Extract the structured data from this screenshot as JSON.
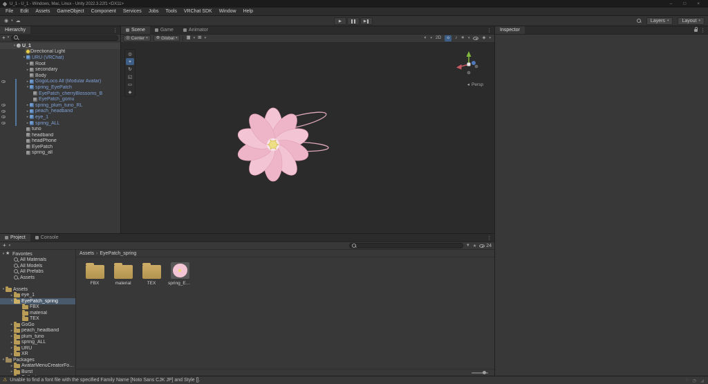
{
  "icons": {
    "plus": "+",
    "caret": "▾",
    "kebab": "⋮",
    "warning": "⚠",
    "crumb_sep": "›",
    "min": "–",
    "max": "□",
    "close": "×",
    "cloud": "☁",
    "person": "◉",
    "play": "▶",
    "shading": "◐",
    "bulb": "☼",
    "audio": "♪",
    "fx": "∗",
    "gizmos": "◈",
    "grid": "▦",
    "snap": "⊞",
    "pivot": "◎",
    "globe": "⊕",
    "funnel": "▼",
    "star": "★",
    "spinner": "◌",
    "clock": "◷",
    "grip": "◢",
    "persp_arrow": "◂"
  },
  "title_bar": {
    "title": "U_1 - U_1 - Windows, Mac, Linux - Unity 2022.3.22f1 <DX11>"
  },
  "menu_bar": {
    "items": [
      {
        "label": "File"
      },
      {
        "label": "Edit"
      },
      {
        "label": "Assets"
      },
      {
        "label": "GameObject"
      },
      {
        "label": "Component"
      },
      {
        "label": "Services"
      },
      {
        "label": "Jobs"
      },
      {
        "label": "Tools"
      },
      {
        "label": "VRChat SDK"
      },
      {
        "label": "Window"
      },
      {
        "label": "Help"
      }
    ]
  },
  "top_toolbar": {
    "layers": "Layers",
    "layout": "Layout"
  },
  "hierarchy": {
    "tab": "Hierarchy",
    "rows": [
      {
        "label": "U_1",
        "depth": "0",
        "ic": "scene",
        "arrow": "exp",
        "pf": "",
        "gut": "",
        "hdr": "1"
      },
      {
        "label": "Directional Light",
        "depth": "1",
        "ic": "light",
        "arrow": "",
        "pf": "",
        "gut": ""
      },
      {
        "label": "URU (VRChat)",
        "depth": "1",
        "ic": "prefab",
        "arrow": "exp",
        "pf": "1",
        "gut": ""
      },
      {
        "label": "Root",
        "depth": "2",
        "ic": "cube",
        "arrow": "col",
        "pf": "",
        "gut": ""
      },
      {
        "label": "secondary",
        "depth": "2",
        "ic": "cube",
        "arrow": "col",
        "pf": "",
        "gut": ""
      },
      {
        "label": "Body",
        "depth": "2",
        "ic": "cube",
        "arrow": "",
        "pf": "",
        "gut": ""
      },
      {
        "label": "GogoLoco All (Modular Avatar)",
        "depth": "2",
        "ic": "prefab",
        "arrow": "col",
        "pf": "1",
        "gut": "1"
      },
      {
        "label": "spring_EyePatch",
        "depth": "2",
        "ic": "prefab",
        "arrow": "exp",
        "pf": "1",
        "gut": ""
      },
      {
        "label": "EyePatch_cherryBlossoms_B",
        "depth": "3",
        "ic": "cube",
        "arrow": "",
        "pf": "1",
        "gut": ""
      },
      {
        "label": "EyePatch_gomu",
        "depth": "3",
        "ic": "cube",
        "arrow": "",
        "pf": "1",
        "gut": ""
      },
      {
        "label": "spring_plum_tuno_RL",
        "depth": "2",
        "ic": "prefab",
        "arrow": "col",
        "pf": "1",
        "gut": "1"
      },
      {
        "label": "peach_headband",
        "depth": "2",
        "ic": "prefab",
        "arrow": "col",
        "pf": "1",
        "gut": "1"
      },
      {
        "label": "eye_1",
        "depth": "2",
        "ic": "prefab",
        "arrow": "col",
        "pf": "1",
        "gut": "1"
      },
      {
        "label": "spring_ALL",
        "depth": "2",
        "ic": "prefab",
        "arrow": "col",
        "pf": "1",
        "gut": "1"
      },
      {
        "label": "tuno",
        "depth": "1",
        "ic": "cube",
        "arrow": "",
        "pf": "",
        "gut": ""
      },
      {
        "label": "headband",
        "depth": "1",
        "ic": "cube",
        "arrow": "",
        "pf": "",
        "gut": ""
      },
      {
        "label": "headPhone",
        "depth": "1",
        "ic": "cube",
        "arrow": "",
        "pf": "",
        "gut": ""
      },
      {
        "label": "EyePatch",
        "depth": "1",
        "ic": "cube",
        "arrow": "",
        "pf": "",
        "gut": ""
      },
      {
        "label": "spring_all",
        "depth": "1",
        "ic": "cube",
        "arrow": "",
        "pf": "",
        "gut": ""
      }
    ]
  },
  "scene_view": {
    "tabs": [
      {
        "label": "Scene",
        "active": "1",
        "name": "tab-scene"
      },
      {
        "label": "Game",
        "active": "",
        "name": "tab-game"
      },
      {
        "label": "Animator",
        "active": "",
        "name": "tab-animator"
      }
    ],
    "toolbar": {
      "pivot": "Center",
      "orientation": "Global",
      "two_d": "2D"
    },
    "tools": [
      {
        "glyph": "◎",
        "name": "view-tool",
        "active": ""
      },
      {
        "glyph": "+",
        "name": "move-tool",
        "active": "1"
      },
      {
        "glyph": "↻",
        "name": "rotate-tool",
        "active": ""
      },
      {
        "glyph": "◱",
        "name": "scale-tool",
        "active": ""
      },
      {
        "glyph": "▭",
        "name": "rect-tool",
        "active": ""
      },
      {
        "glyph": "◈",
        "name": "transform-tool",
        "active": ""
      }
    ],
    "gizmo_label": "Persp"
  },
  "inspector": {
    "tab": "Inspector"
  },
  "project": {
    "tabs": [
      {
        "label": "Project",
        "active": "1",
        "name": "tab-project"
      },
      {
        "label": "Console",
        "active": "",
        "name": "tab-console"
      }
    ],
    "hidden_count": "24",
    "tree": [
      {
        "label": "Favorites",
        "depth": "0",
        "ic": "star",
        "arrow": "exp"
      },
      {
        "label": "All Materials",
        "depth": "1",
        "ic": "search"
      },
      {
        "label": "All Models",
        "depth": "1",
        "ic": "search"
      },
      {
        "label": "All Prefabs",
        "depth": "1",
        "ic": "search"
      },
      {
        "label": "Assets",
        "depth": "1",
        "ic": "search"
      },
      {
        "sp": "1"
      },
      {
        "label": "Assets",
        "depth": "0",
        "ic": "folder",
        "arrow": "exp"
      },
      {
        "label": "eye_1",
        "depth": "1",
        "ic": "folder",
        "arrow": "col"
      },
      {
        "label": "EyePatch_spring",
        "depth": "1",
        "ic": "folder-open",
        "arrow": "exp",
        "sel": "1"
      },
      {
        "label": "FBX",
        "depth": "2",
        "ic": "folder"
      },
      {
        "label": "material",
        "depth": "2",
        "ic": "folder"
      },
      {
        "label": "TEX",
        "depth": "2",
        "ic": "folder"
      },
      {
        "label": "GoGo",
        "depth": "1",
        "ic": "folder",
        "arrow": "col"
      },
      {
        "label": "peach_headband",
        "depth": "1",
        "ic": "folder",
        "arrow": "col"
      },
      {
        "label": "plum_tuno",
        "depth": "1",
        "ic": "folder",
        "arrow": "col"
      },
      {
        "label": "spring_ALL",
        "depth": "1",
        "ic": "folder",
        "arrow": "col"
      },
      {
        "label": "URU",
        "depth": "1",
        "ic": "folder",
        "arrow": "col"
      },
      {
        "label": "XR",
        "depth": "1",
        "ic": "folder",
        "arrow": "col"
      },
      {
        "label": "Packages",
        "depth": "0",
        "ic": "package",
        "arrow": "exp"
      },
      {
        "label": "AvatarMenuCreatorForMA",
        "depth": "1",
        "ic": "folder",
        "arrow": "col"
      },
      {
        "label": "Burst",
        "depth": "1",
        "ic": "folder",
        "arrow": "col"
      },
      {
        "label": "Collections",
        "depth": "1",
        "ic": "folder",
        "arrow": "col"
      }
    ],
    "breadcrumb": {
      "root": "Assets",
      "current": "EyePatch_spring"
    },
    "items": [
      {
        "label": "FBX",
        "kind": "folder"
      },
      {
        "label": "material",
        "kind": "folder"
      },
      {
        "label": "TEX",
        "kind": "folder"
      },
      {
        "label": "spring_Eye...",
        "kind": "flower"
      }
    ]
  },
  "status_bar": {
    "message": "Unable to find a font file with the specified Family Name [Noto Sans CJK JP] and Style []."
  }
}
